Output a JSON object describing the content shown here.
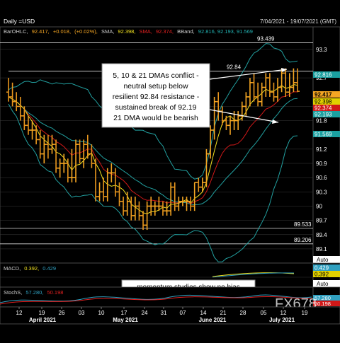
{
  "header": {
    "title": "Daily =USD",
    "date_range": "7/04/2021 - 19/07/2021 (GMT)"
  },
  "legend": {
    "bar_label": "BarOHLC,",
    "bar_value": "92.417,",
    "bar_change": "+0.018,",
    "bar_pct": "(+0.02%),",
    "sma1_label": "SMA,",
    "sma1_value": "92.398,",
    "sma2_label": "SMA,",
    "sma2_value": "92.374,",
    "bband_label": "BBand,",
    "bband_values": "92.816, 92.193, 91.569"
  },
  "colors": {
    "background": "#000000",
    "grid": "#3a3a3a",
    "candle_up": "#f5a623",
    "candle_down": "#e8961e",
    "sma_fast": "#f0e020",
    "sma_slow": "#d01818",
    "bband": "#22a0a0",
    "price_box": "#f5a623",
    "sma_box": "#e0d000",
    "sma2_box": "#d01818",
    "band_box": "#1aa0a0",
    "macd": "#f0e020",
    "macd_signal": "#30a0c0",
    "stoch": "#30a0c0",
    "stoch_signal": "#e02020"
  },
  "annotations": {
    "main_box_lines": [
      "5, 10 & 21 DMAs conflict -",
      "neutral setup below",
      "resilient 92.84 resistance -",
      "sustained break of 92.19",
      "21 DMA would be bearish"
    ],
    "momentum_box": "momentum studies show no bias",
    "level_9284": "92.84",
    "level_93439": "93.439",
    "level_89533": "89.533",
    "level_89206": "89.206"
  },
  "right_axis": {
    "ticks": [
      "93.3",
      "92.7",
      "92.1",
      "91.8",
      "91.2",
      "90.9",
      "90.6",
      "90.3",
      "90",
      "89.7",
      "89.4",
      "89.1"
    ],
    "boxes": {
      "upper_band": "92.816",
      "price": "92.417",
      "sma_fast": "92.398",
      "sma_slow": "92.374",
      "mid_band": "92.193",
      "lower_band": "91.569"
    },
    "auto_label": "Auto"
  },
  "macd_panel": {
    "label": "MACD,",
    "value1": "0.392,",
    "value2": "0.429",
    "box1": "0.429",
    "box2": "0.392",
    "auto_label": "Auto"
  },
  "stoch_panel": {
    "label": "StochS,",
    "value1": "57.280,",
    "value2": "50.198",
    "box1": "57.280",
    "box2": "50.198"
  },
  "watermark": "FX678",
  "x_axis": {
    "day_ticks": [
      "12",
      "19",
      "26",
      "03",
      "10",
      "17",
      "24",
      "31",
      "07",
      "14",
      "21",
      "28",
      "05",
      "12",
      "19"
    ],
    "months": [
      "April 2021",
      "May 2021",
      "June 2021",
      "July 2021"
    ]
  },
  "chart_data": {
    "type": "bar",
    "x": [
      "2021-04-07",
      "2021-04-08",
      "2021-04-09",
      "2021-04-12",
      "2021-04-13",
      "2021-04-14",
      "2021-04-15",
      "2021-04-16",
      "2021-04-19",
      "2021-04-20",
      "2021-04-21",
      "2021-04-22",
      "2021-04-23",
      "2021-04-26",
      "2021-04-27",
      "2021-04-28",
      "2021-04-29",
      "2021-04-30",
      "2021-05-03",
      "2021-05-04",
      "2021-05-05",
      "2021-05-06",
      "2021-05-07",
      "2021-05-10",
      "2021-05-11",
      "2021-05-12",
      "2021-05-13",
      "2021-05-14",
      "2021-05-17",
      "2021-05-18",
      "2021-05-19",
      "2021-05-20",
      "2021-05-21",
      "2021-05-24",
      "2021-05-25",
      "2021-05-26",
      "2021-05-27",
      "2021-05-28",
      "2021-05-31",
      "2021-06-01",
      "2021-06-02",
      "2021-06-03",
      "2021-06-04",
      "2021-06-07",
      "2021-06-08",
      "2021-06-09",
      "2021-06-10",
      "2021-06-11",
      "2021-06-14",
      "2021-06-15",
      "2021-06-16",
      "2021-06-17",
      "2021-06-18",
      "2021-06-21",
      "2021-06-22",
      "2021-06-23",
      "2021-06-24",
      "2021-06-25",
      "2021-06-28",
      "2021-06-29",
      "2021-06-30",
      "2021-07-01",
      "2021-07-02",
      "2021-07-05",
      "2021-07-06",
      "2021-07-07",
      "2021-07-08",
      "2021-07-09",
      "2021-07-12",
      "2021-07-13",
      "2021-07-14",
      "2021-07-15",
      "2021-07-16",
      "2021-07-19"
    ],
    "series": [
      {
        "name": "Open",
        "values": [
          92.4,
          92.3,
          92.2,
          92.1,
          91.9,
          91.7,
          91.6,
          91.6,
          91.4,
          91.1,
          91.3,
          91.2,
          91.3,
          90.8,
          90.9,
          90.9,
          90.6,
          90.6,
          91.3,
          91.0,
          91.3,
          91.1,
          90.9,
          90.2,
          90.3,
          90.2,
          90.7,
          90.7,
          90.3,
          90.1,
          89.9,
          90.1,
          89.8,
          90.0,
          89.8,
          89.6,
          90.0,
          90.0,
          90.0,
          90.0,
          89.9,
          89.9,
          90.4,
          90.0,
          90.1,
          90.1,
          90.1,
          90.0,
          90.5,
          90.4,
          90.5,
          91.1,
          91.6,
          92.2,
          92.0,
          91.8,
          91.7,
          91.8,
          91.8,
          91.9,
          92.1,
          92.3,
          92.6,
          92.3,
          92.2,
          92.5,
          92.7,
          92.4,
          92.3,
          92.5,
          92.8,
          92.4,
          92.5,
          92.6
        ]
      },
      {
        "name": "High",
        "values": [
          92.7,
          92.6,
          92.4,
          92.3,
          92.1,
          91.9,
          91.8,
          91.7,
          91.6,
          91.5,
          91.5,
          91.5,
          91.4,
          91.0,
          91.1,
          91.0,
          91.2,
          91.4,
          91.4,
          91.4,
          91.5,
          91.3,
          91.0,
          90.5,
          90.6,
          90.8,
          90.9,
          90.8,
          90.5,
          90.2,
          90.3,
          90.2,
          90.2,
          90.1,
          89.9,
          90.1,
          90.2,
          90.1,
          90.2,
          90.1,
          90.1,
          90.5,
          90.5,
          90.2,
          90.2,
          90.2,
          90.2,
          90.5,
          90.6,
          90.6,
          91.2,
          91.7,
          92.3,
          92.4,
          92.1,
          91.9,
          91.9,
          92.0,
          92.0,
          92.2,
          92.4,
          92.7,
          92.8,
          92.6,
          92.6,
          92.8,
          92.8,
          92.6,
          92.7,
          92.9,
          92.9,
          92.8,
          92.9,
          92.9
        ]
      },
      {
        "name": "Low",
        "values": [
          92.2,
          92.1,
          92.0,
          91.8,
          91.6,
          91.5,
          91.4,
          91.3,
          91.0,
          90.9,
          91.0,
          91.1,
          90.7,
          90.6,
          90.7,
          90.5,
          90.5,
          90.5,
          90.9,
          90.8,
          91.0,
          90.8,
          90.1,
          90.1,
          90.1,
          90.1,
          90.5,
          90.2,
          90.0,
          89.8,
          89.8,
          89.7,
          89.7,
          89.7,
          89.5,
          89.5,
          89.8,
          89.8,
          89.9,
          89.8,
          89.8,
          89.8,
          89.9,
          89.9,
          90.0,
          89.9,
          89.9,
          89.9,
          90.3,
          90.3,
          90.4,
          91.0,
          91.4,
          91.8,
          91.7,
          91.6,
          91.5,
          91.6,
          91.6,
          91.8,
          91.9,
          92.1,
          92.2,
          92.1,
          92.1,
          92.3,
          92.3,
          92.2,
          92.2,
          92.4,
          92.3,
          92.3,
          92.4,
          92.4
        ]
      },
      {
        "name": "Close",
        "values": [
          92.3,
          92.2,
          92.1,
          91.9,
          91.7,
          91.6,
          91.6,
          91.4,
          91.1,
          91.3,
          91.2,
          91.3,
          90.8,
          90.9,
          90.9,
          90.6,
          90.6,
          91.3,
          91.0,
          91.3,
          91.1,
          90.9,
          90.2,
          90.3,
          90.2,
          90.7,
          90.7,
          90.3,
          90.1,
          89.9,
          90.1,
          89.8,
          90.0,
          89.8,
          89.6,
          90.0,
          90.0,
          90.0,
          90.0,
          89.9,
          89.9,
          90.4,
          90.0,
          90.1,
          90.1,
          90.1,
          90.0,
          90.5,
          90.4,
          90.5,
          91.1,
          91.6,
          92.2,
          92.0,
          91.8,
          91.7,
          91.8,
          91.8,
          91.9,
          92.1,
          92.3,
          92.6,
          92.3,
          92.2,
          92.5,
          92.7,
          92.4,
          92.3,
          92.5,
          92.8,
          92.4,
          92.5,
          92.6,
          92.417
        ]
      }
    ],
    "ylim": [
      88.95,
      93.55
    ],
    "reference_lines": [
      93.439,
      92.84,
      89.533,
      89.206
    ]
  }
}
